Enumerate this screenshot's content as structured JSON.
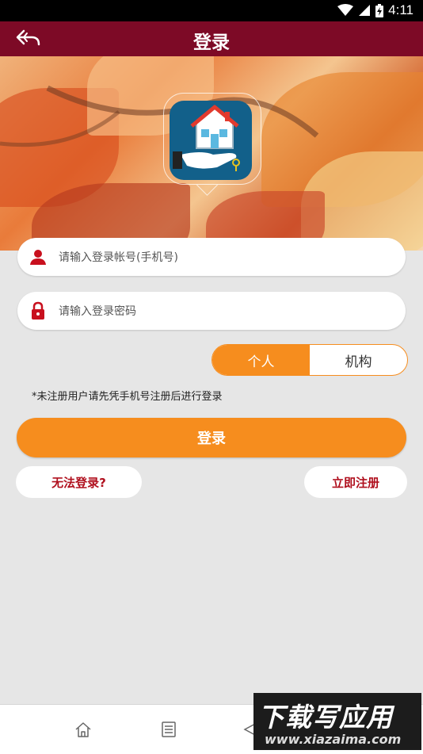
{
  "status_bar": {
    "time": "4:11",
    "icons": [
      "wifi-icon",
      "signal-icon",
      "battery-icon"
    ]
  },
  "header": {
    "title": "登录",
    "back_icon": "back-arrow-icon"
  },
  "form": {
    "account_placeholder": "请输入登录帐号(手机号)",
    "password_placeholder": "请输入登录密码",
    "account_icon": "user-icon",
    "password_icon": "lock-icon"
  },
  "user_type": {
    "options": [
      "个人",
      "机构"
    ],
    "selected": "个人"
  },
  "notice": "*未注册用户请先凭手机号注册后进行登录",
  "actions": {
    "login": "登录",
    "cannot_login": "无法登录?",
    "register": "立即注册"
  },
  "nav": {
    "icons": [
      "home-icon",
      "list-icon",
      "send-icon"
    ]
  },
  "watermark": {
    "text": "下载写应用",
    "url": "www.xiazaima.com"
  },
  "colors": {
    "header": "#7d0a26",
    "accent": "#f68d1e",
    "link": "#b0101e",
    "logo_bg": "#12608a"
  }
}
